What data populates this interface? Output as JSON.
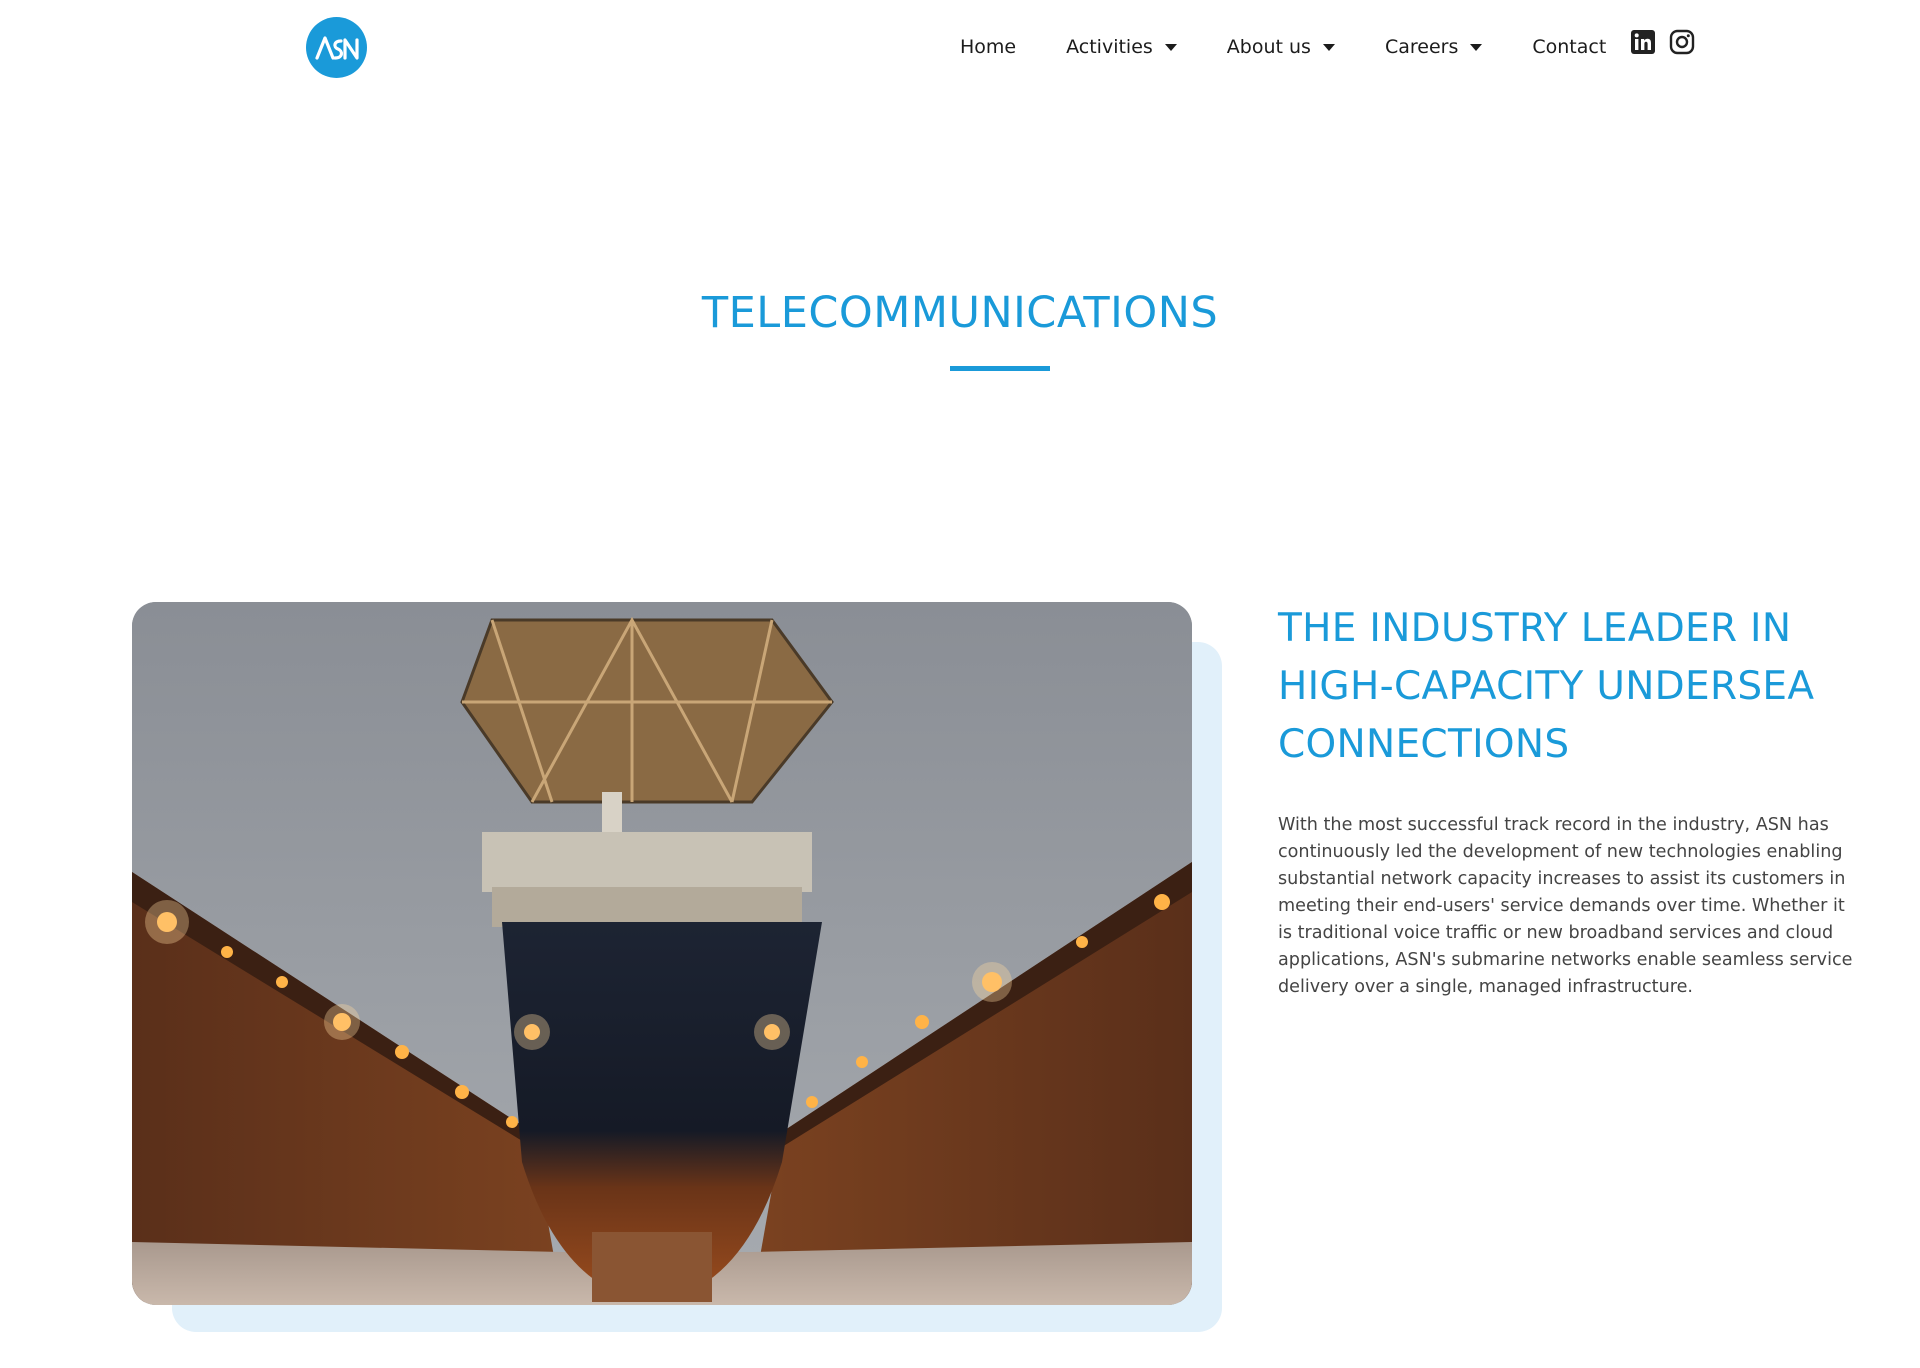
{
  "brand": {
    "logo_text": "ASN",
    "accent_color": "#1a9ad9",
    "light_accent_color": "#e1f0fa"
  },
  "nav": {
    "items": [
      {
        "label": "Home",
        "has_dropdown": false
      },
      {
        "label": "Activities",
        "has_dropdown": true
      },
      {
        "label": "About us",
        "has_dropdown": true
      },
      {
        "label": "Careers",
        "has_dropdown": true
      },
      {
        "label": "Contact",
        "has_dropdown": false
      }
    ],
    "social": [
      {
        "icon": "linkedin-icon"
      },
      {
        "icon": "instagram-icon"
      }
    ]
  },
  "page": {
    "title": "TELECOMMUNICATIONS"
  },
  "section": {
    "image_icon": "cable-ship-in-dry-dock-image",
    "heading": "THE INDUSTRY LEADER IN HIGH-CAPACITY UNDERSEA CONNECTIONS",
    "body": "With the most successful track record in the industry, ASN has continuously led the development of new technologies enabling substantial network capacity increases to assist its customers in meeting their end-users' service demands over time. Whether it is traditional voice traffic or new broadband services and cloud applications, ASN's submarine networks enable seamless service delivery over a single, managed infrastructure."
  }
}
